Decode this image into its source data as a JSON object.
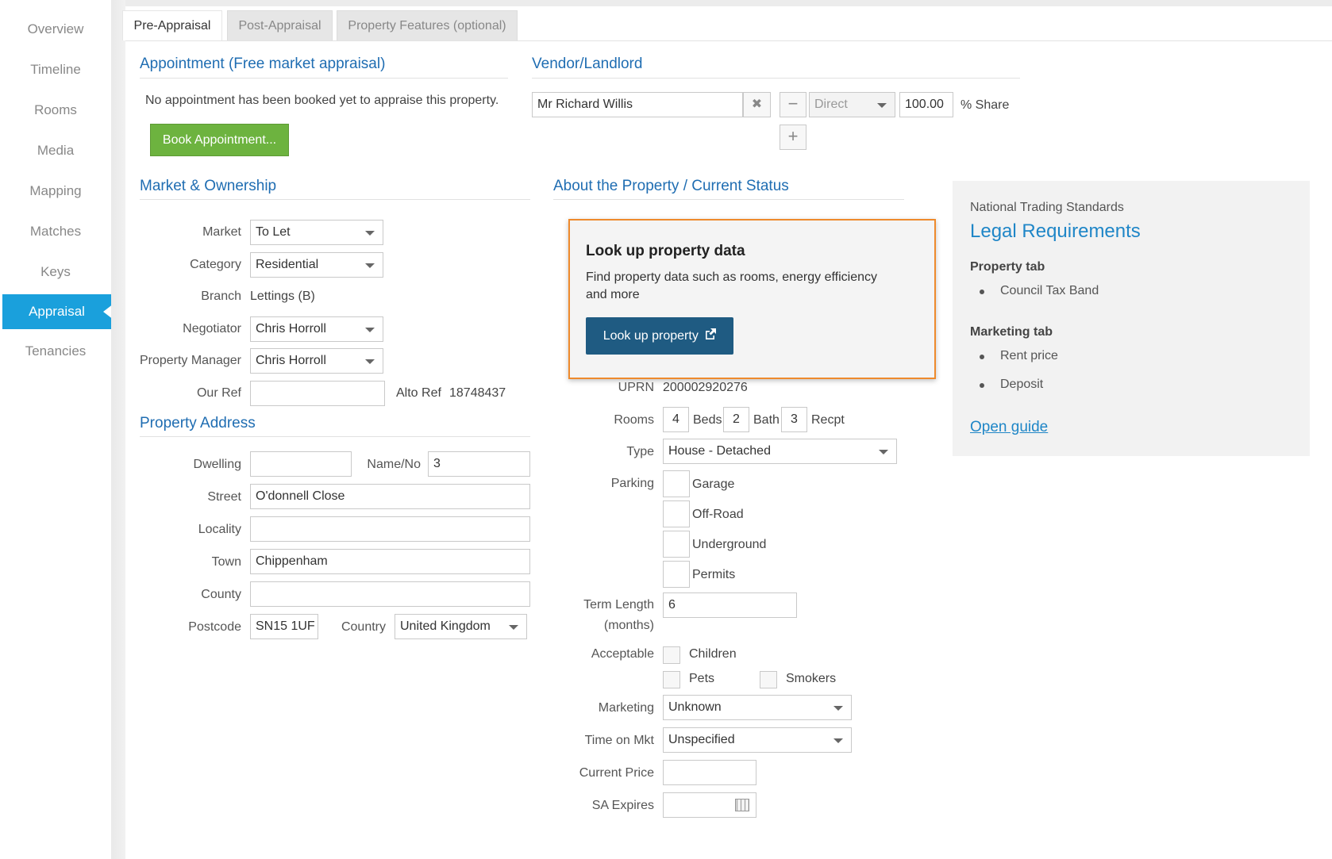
{
  "sidebar": {
    "items": [
      {
        "label": "Overview"
      },
      {
        "label": "Timeline"
      },
      {
        "label": "Rooms"
      },
      {
        "label": "Media"
      },
      {
        "label": "Mapping"
      },
      {
        "label": "Matches"
      },
      {
        "label": "Keys"
      },
      {
        "label": "Appraisal",
        "active": true
      },
      {
        "label": "Tenancies"
      }
    ]
  },
  "tabs": [
    {
      "label": "Pre-Appraisal",
      "active": true
    },
    {
      "label": "Post-Appraisal"
    },
    {
      "label": "Property Features (optional)"
    }
  ],
  "appointment": {
    "title": "Appointment (Free market appraisal)",
    "message": "No appointment has been booked yet to appraise this property.",
    "button": "Book Appointment..."
  },
  "vendor": {
    "title": "Vendor/Landlord",
    "name": "Mr Richard Willis",
    "type": "Direct",
    "share": "100.00",
    "share_label": "% Share"
  },
  "market": {
    "title": "Market & Ownership",
    "market_label": "Market",
    "market_value": "To Let",
    "category_label": "Category",
    "category_value": "Residential",
    "branch_label": "Branch",
    "branch_value": "Lettings (B)",
    "negotiator_label": "Negotiator",
    "negotiator_value": "Chris Horroll",
    "manager_label": "Property Manager",
    "manager_value": "Chris Horroll",
    "ourref_label": "Our Ref",
    "ourref_value": "",
    "altoref_label": "Alto Ref",
    "altoref_value": "18748437"
  },
  "address": {
    "title": "Property Address",
    "dwelling_label": "Dwelling",
    "dwelling_value": "",
    "nameno_label": "Name/No",
    "nameno_value": "3",
    "street_label": "Street",
    "street_value": "O'donnell Close",
    "locality_label": "Locality",
    "locality_value": "",
    "town_label": "Town",
    "town_value": "Chippenham",
    "county_label": "County",
    "county_value": "",
    "postcode_label": "Postcode",
    "postcode_value": "SN15 1UF",
    "country_label": "Country",
    "country_value": "United Kingdom"
  },
  "about": {
    "title": "About the Property / Current Status",
    "lookup_title": "Look up property data",
    "lookup_desc": "Find property data such as rooms, energy efficiency and more",
    "lookup_button": "Look up property",
    "uprn_label": "UPRN",
    "uprn_value": "200002920276",
    "rooms_label": "Rooms",
    "beds_value": "4",
    "beds_label": "Beds",
    "bath_value": "2",
    "bath_label": "Bath",
    "recpt_value": "3",
    "recpt_label": "Recpt",
    "type_label": "Type",
    "type_value": "House - Detached",
    "parking_label": "Parking",
    "parking_options": [
      "Garage",
      "Off-Road",
      "Underground",
      "Permits"
    ],
    "term_label_1": "Term Length",
    "term_label_2": "(months)",
    "term_value": "6",
    "acceptable_label": "Acceptable",
    "acceptable_children": "Children",
    "acceptable_pets": "Pets",
    "acceptable_smokers": "Smokers",
    "marketing_label": "Marketing",
    "marketing_value": "Unknown",
    "timeonmkt_label": "Time on Mkt",
    "timeonmkt_value": "Unspecified",
    "price_label": "Current Price",
    "price_value": "",
    "saexpires_label": "SA Expires",
    "saexpires_value": ""
  },
  "legal": {
    "small": "National Trading Standards",
    "title": "Legal Requirements",
    "property_tab": "Property tab",
    "property_items": [
      "Council Tax Band"
    ],
    "marketing_tab": "Marketing tab",
    "marketing_items": [
      "Rent price",
      "Deposit"
    ],
    "link": "Open guide"
  }
}
